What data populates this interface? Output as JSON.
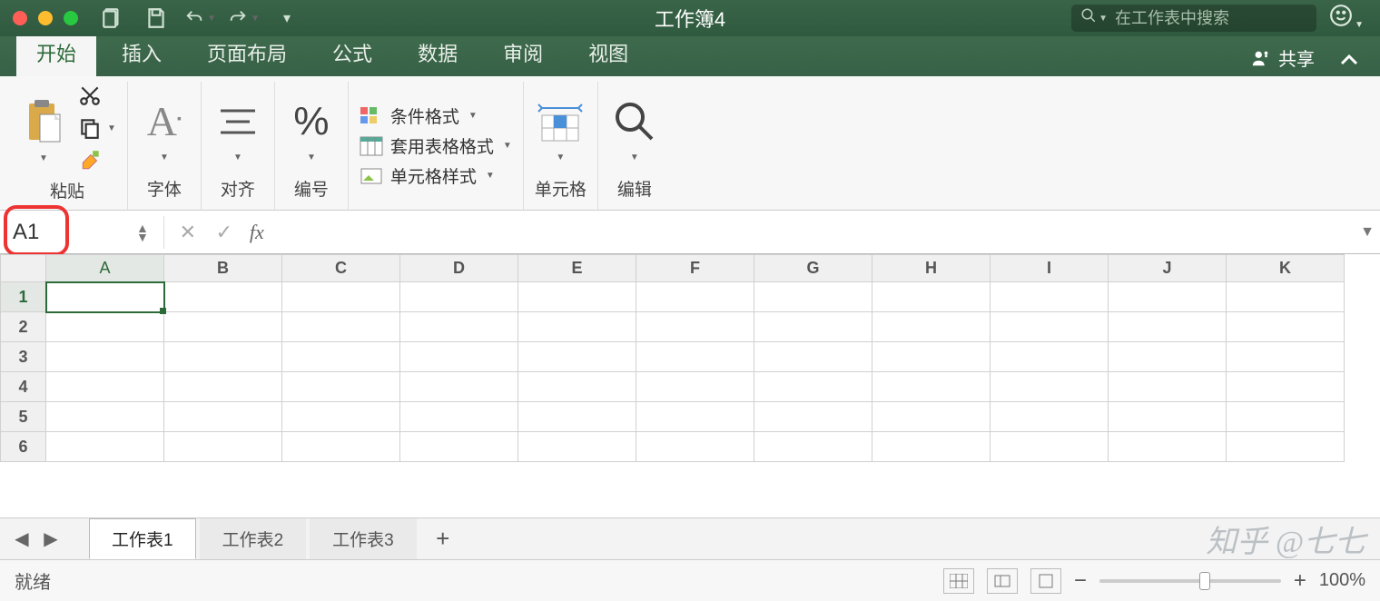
{
  "titlebar": {
    "title": "工作簿4",
    "search_placeholder": "在工作表中搜索"
  },
  "tabs": {
    "items": [
      "开始",
      "插入",
      "页面布局",
      "公式",
      "数据",
      "审阅",
      "视图"
    ],
    "active_index": 0,
    "share_label": "共享"
  },
  "ribbon": {
    "paste_label": "粘贴",
    "font_label": "字体",
    "align_label": "对齐",
    "number_label": "编号",
    "cond_fmt": "条件格式",
    "table_fmt": "套用表格格式",
    "cell_style": "单元格样式",
    "cells_label": "单元格",
    "edit_label": "编辑"
  },
  "formula_bar": {
    "name_box": "A1",
    "fx_label": "fx",
    "value": ""
  },
  "grid": {
    "columns": [
      "A",
      "B",
      "C",
      "D",
      "E",
      "F",
      "G",
      "H",
      "I",
      "J",
      "K"
    ],
    "rows": [
      1,
      2,
      3,
      4,
      5,
      6
    ],
    "selected": "A1"
  },
  "sheets": {
    "items": [
      "工作表1",
      "工作表2",
      "工作表3"
    ],
    "active_index": 0
  },
  "statusbar": {
    "ready": "就绪",
    "zoom": "100%"
  },
  "watermark": "知乎 @七七"
}
